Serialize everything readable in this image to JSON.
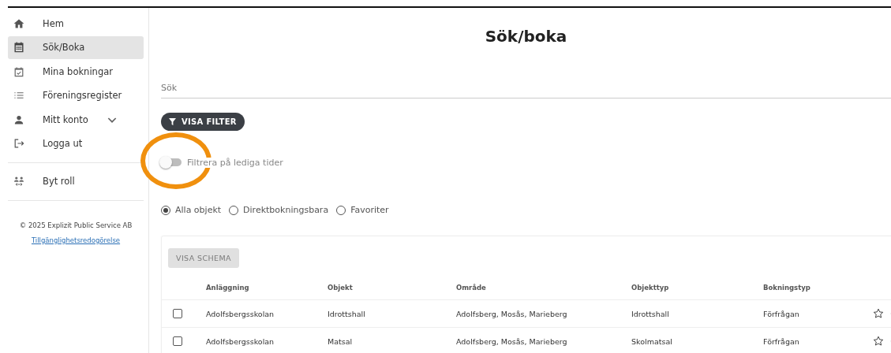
{
  "sidebar": {
    "items": [
      {
        "label": "Hem",
        "selected": false
      },
      {
        "label": "Sök/Boka",
        "selected": true
      },
      {
        "label": "Mina bokningar",
        "selected": false
      },
      {
        "label": "Föreningsregister",
        "selected": false
      },
      {
        "label": "Mitt konto",
        "selected": false,
        "expandable": true
      },
      {
        "label": "Logga ut",
        "selected": false
      }
    ],
    "role_item": {
      "label": "Byt roll"
    },
    "copyright": "© 2025 Explizit Public Service AB",
    "accessibility_link": "Tillgänglighetsredogörelse"
  },
  "page_title": "Sök/boka",
  "search": {
    "placeholder": "Sök"
  },
  "filter_button": "VISA FILTER",
  "free_times_toggle": {
    "label": "Filtrera på lediga tider",
    "on": false
  },
  "object_filter": [
    {
      "label": "Alla objekt",
      "selected": true
    },
    {
      "label": "Direktbokningsbara",
      "selected": false
    },
    {
      "label": "Favoriter",
      "selected": false
    }
  ],
  "schedule_button": {
    "label": "VISA SCHEMA",
    "disabled": true
  },
  "table": {
    "columns": [
      "Anläggning",
      "Objekt",
      "Område",
      "Objekttyp",
      "Bokningstyp"
    ],
    "rows": [
      {
        "checked": false,
        "cells": [
          "Adolfsbergsskolan",
          "Idrottshall",
          "Adolfsberg, Mosås, Marieberg",
          "Idrottshall",
          "Förfrågan"
        ],
        "favorite": false
      },
      {
        "checked": false,
        "cells": [
          "Adolfsbergsskolan",
          "Matsal",
          "Adolfsberg, Mosås, Marieberg",
          "Skolmatsal",
          "Förfrågan"
        ],
        "favorite": false
      }
    ]
  }
}
